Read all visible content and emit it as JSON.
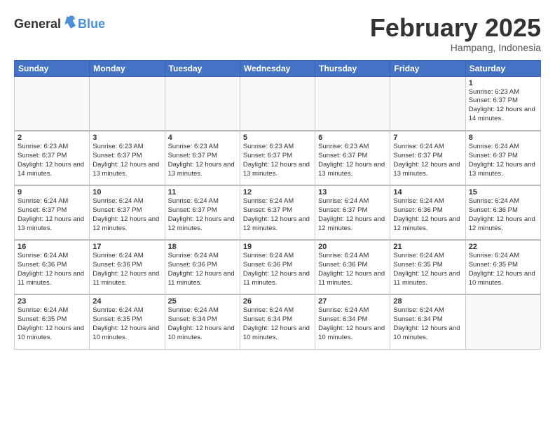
{
  "header": {
    "logo": {
      "general": "General",
      "blue": "Blue",
      "bird_unicode": "▶"
    },
    "title": "February 2025",
    "location": "Hampang, Indonesia"
  },
  "calendar": {
    "days_of_week": [
      "Sunday",
      "Monday",
      "Tuesday",
      "Wednesday",
      "Thursday",
      "Friday",
      "Saturday"
    ],
    "weeks": [
      {
        "days": [
          {
            "num": "",
            "empty": true
          },
          {
            "num": "",
            "empty": true
          },
          {
            "num": "",
            "empty": true
          },
          {
            "num": "",
            "empty": true
          },
          {
            "num": "",
            "empty": true
          },
          {
            "num": "",
            "empty": true
          },
          {
            "num": "1",
            "sunrise": "Sunrise: 6:23 AM",
            "sunset": "Sunset: 6:37 PM",
            "daylight": "Daylight: 12 hours and 14 minutes."
          }
        ]
      },
      {
        "days": [
          {
            "num": "2",
            "sunrise": "Sunrise: 6:23 AM",
            "sunset": "Sunset: 6:37 PM",
            "daylight": "Daylight: 12 hours and 14 minutes."
          },
          {
            "num": "3",
            "sunrise": "Sunrise: 6:23 AM",
            "sunset": "Sunset: 6:37 PM",
            "daylight": "Daylight: 12 hours and 13 minutes."
          },
          {
            "num": "4",
            "sunrise": "Sunrise: 6:23 AM",
            "sunset": "Sunset: 6:37 PM",
            "daylight": "Daylight: 12 hours and 13 minutes."
          },
          {
            "num": "5",
            "sunrise": "Sunrise: 6:23 AM",
            "sunset": "Sunset: 6:37 PM",
            "daylight": "Daylight: 12 hours and 13 minutes."
          },
          {
            "num": "6",
            "sunrise": "Sunrise: 6:23 AM",
            "sunset": "Sunset: 6:37 PM",
            "daylight": "Daylight: 12 hours and 13 minutes."
          },
          {
            "num": "7",
            "sunrise": "Sunrise: 6:24 AM",
            "sunset": "Sunset: 6:37 PM",
            "daylight": "Daylight: 12 hours and 13 minutes."
          },
          {
            "num": "8",
            "sunrise": "Sunrise: 6:24 AM",
            "sunset": "Sunset: 6:37 PM",
            "daylight": "Daylight: 12 hours and 13 minutes."
          }
        ]
      },
      {
        "days": [
          {
            "num": "9",
            "sunrise": "Sunrise: 6:24 AM",
            "sunset": "Sunset: 6:37 PM",
            "daylight": "Daylight: 12 hours and 13 minutes."
          },
          {
            "num": "10",
            "sunrise": "Sunrise: 6:24 AM",
            "sunset": "Sunset: 6:37 PM",
            "daylight": "Daylight: 12 hours and 12 minutes."
          },
          {
            "num": "11",
            "sunrise": "Sunrise: 6:24 AM",
            "sunset": "Sunset: 6:37 PM",
            "daylight": "Daylight: 12 hours and 12 minutes."
          },
          {
            "num": "12",
            "sunrise": "Sunrise: 6:24 AM",
            "sunset": "Sunset: 6:37 PM",
            "daylight": "Daylight: 12 hours and 12 minutes."
          },
          {
            "num": "13",
            "sunrise": "Sunrise: 6:24 AM",
            "sunset": "Sunset: 6:37 PM",
            "daylight": "Daylight: 12 hours and 12 minutes."
          },
          {
            "num": "14",
            "sunrise": "Sunrise: 6:24 AM",
            "sunset": "Sunset: 6:36 PM",
            "daylight": "Daylight: 12 hours and 12 minutes."
          },
          {
            "num": "15",
            "sunrise": "Sunrise: 6:24 AM",
            "sunset": "Sunset: 6:36 PM",
            "daylight": "Daylight: 12 hours and 12 minutes."
          }
        ]
      },
      {
        "days": [
          {
            "num": "16",
            "sunrise": "Sunrise: 6:24 AM",
            "sunset": "Sunset: 6:36 PM",
            "daylight": "Daylight: 12 hours and 11 minutes."
          },
          {
            "num": "17",
            "sunrise": "Sunrise: 6:24 AM",
            "sunset": "Sunset: 6:36 PM",
            "daylight": "Daylight: 12 hours and 11 minutes."
          },
          {
            "num": "18",
            "sunrise": "Sunrise: 6:24 AM",
            "sunset": "Sunset: 6:36 PM",
            "daylight": "Daylight: 12 hours and 11 minutes."
          },
          {
            "num": "19",
            "sunrise": "Sunrise: 6:24 AM",
            "sunset": "Sunset: 6:36 PM",
            "daylight": "Daylight: 12 hours and 11 minutes."
          },
          {
            "num": "20",
            "sunrise": "Sunrise: 6:24 AM",
            "sunset": "Sunset: 6:36 PM",
            "daylight": "Daylight: 12 hours and 11 minutes."
          },
          {
            "num": "21",
            "sunrise": "Sunrise: 6:24 AM",
            "sunset": "Sunset: 6:35 PM",
            "daylight": "Daylight: 12 hours and 11 minutes."
          },
          {
            "num": "22",
            "sunrise": "Sunrise: 6:24 AM",
            "sunset": "Sunset: 6:35 PM",
            "daylight": "Daylight: 12 hours and 10 minutes."
          }
        ]
      },
      {
        "days": [
          {
            "num": "23",
            "sunrise": "Sunrise: 6:24 AM",
            "sunset": "Sunset: 6:35 PM",
            "daylight": "Daylight: 12 hours and 10 minutes."
          },
          {
            "num": "24",
            "sunrise": "Sunrise: 6:24 AM",
            "sunset": "Sunset: 6:35 PM",
            "daylight": "Daylight: 12 hours and 10 minutes."
          },
          {
            "num": "25",
            "sunrise": "Sunrise: 6:24 AM",
            "sunset": "Sunset: 6:34 PM",
            "daylight": "Daylight: 12 hours and 10 minutes."
          },
          {
            "num": "26",
            "sunrise": "Sunrise: 6:24 AM",
            "sunset": "Sunset: 6:34 PM",
            "daylight": "Daylight: 12 hours and 10 minutes."
          },
          {
            "num": "27",
            "sunrise": "Sunrise: 6:24 AM",
            "sunset": "Sunset: 6:34 PM",
            "daylight": "Daylight: 12 hours and 10 minutes."
          },
          {
            "num": "28",
            "sunrise": "Sunrise: 6:24 AM",
            "sunset": "Sunset: 6:34 PM",
            "daylight": "Daylight: 12 hours and 10 minutes."
          },
          {
            "num": "",
            "empty": true
          }
        ]
      }
    ]
  }
}
